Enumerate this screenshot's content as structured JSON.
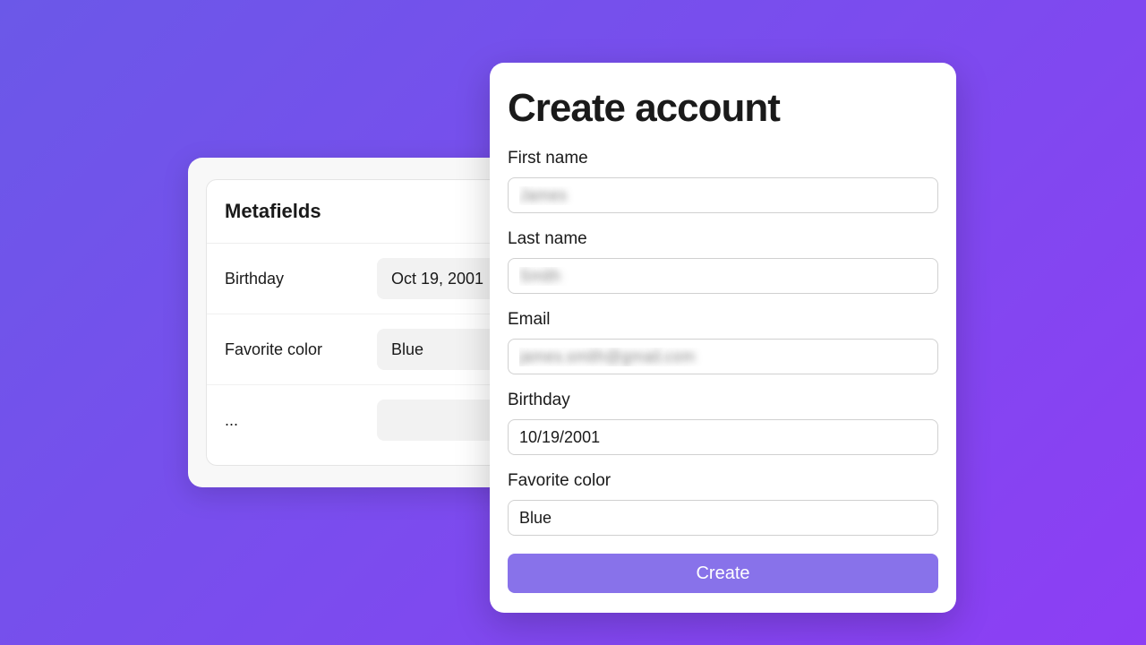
{
  "metafields": {
    "title": "Metafields",
    "rows": [
      {
        "label": "Birthday",
        "value": "Oct 19, 2001"
      },
      {
        "label": "Favorite color",
        "value": "Blue"
      },
      {
        "label": "...",
        "value": ""
      }
    ]
  },
  "modal": {
    "title": "Create account",
    "fields": {
      "first_name": {
        "label": "First name",
        "value": "James"
      },
      "last_name": {
        "label": "Last name",
        "value": "Smith"
      },
      "email": {
        "label": "Email",
        "value": "james.smith@gmail.com"
      },
      "birthday": {
        "label": "Birthday",
        "value": "10/19/2001"
      },
      "favorite_color": {
        "label": "Favorite color",
        "value": "Blue"
      }
    },
    "create_label": "Create"
  }
}
